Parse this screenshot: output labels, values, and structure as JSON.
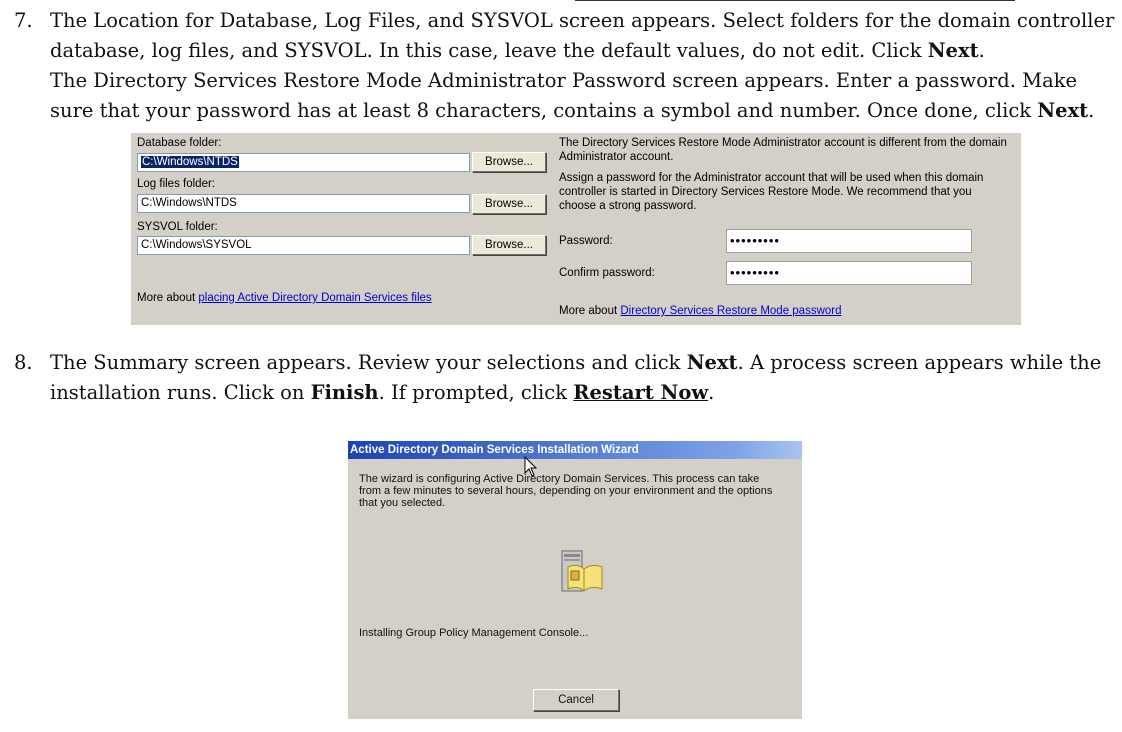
{
  "step7": {
    "number": "7.",
    "line1": "The Location for Database, Log Files, and SYSVOL screen appears. Select folders for the domain controller",
    "line2_a": "database, log files, and SYSVOL. In this case, leave the default values, do not edit. Click ",
    "line2_bold": "Next",
    "line2_end": ".",
    "line3": "The Directory Services Restore Mode Administrator Password screen appears. Enter a password. Make",
    "line4_a": "sure that your password has at least 8 characters, contains a symbol and number. Once done, click ",
    "line4_bold": "Next",
    "line4_end": "."
  },
  "location_screen": {
    "database_label": "Database folder:",
    "database_value": "C:\\Windows\\NTDS",
    "log_label": "Log files folder:",
    "log_value": "C:\\Windows\\NTDS",
    "sysvol_label": "SYSVOL folder:",
    "sysvol_value": "C:\\Windows\\SYSVOL",
    "browse_label": "Browse...",
    "more_prefix": "More about ",
    "more_link": "placing Active Directory Domain Services files"
  },
  "password_screen": {
    "info1": "The Directory Services Restore Mode Administrator account is different from the domain",
    "info2": "Administrator account.",
    "info3": "Assign a password for the Administrator account that will be used when this domain",
    "info4": "controller is started in Directory Services Restore Mode. We recommend that you",
    "info5": "choose a strong password.",
    "password_label": "Password:",
    "password_value": "•••••••••",
    "confirm_label": "Confirm password:",
    "confirm_value": "•••••••••",
    "more_prefix": "More about ",
    "more_link": "Directory Services Restore Mode password"
  },
  "step8": {
    "number": "8.",
    "line1_a": "The Summary screen appears. Review your selections and click ",
    "line1_bold": "Next",
    "line1_end": ". A process screen appears while the",
    "line2_a": "installation runs. Click on ",
    "line2_bold": "Finish",
    "line2_b": ". If prompted, click ",
    "line2_bold2": "Restart Now",
    "line2_end": "."
  },
  "wizard": {
    "title": "Active Directory Domain Services Installation Wizard",
    "desc1": "The wizard is configuring Active Directory Domain Services. This process can take",
    "desc2": "from a few minutes to several hours, depending on your environment and the options",
    "desc3": "that you selected.",
    "status": "Installing Group Policy Management Console...",
    "cancel_label": "Cancel",
    "icon": "server-book-icon"
  }
}
